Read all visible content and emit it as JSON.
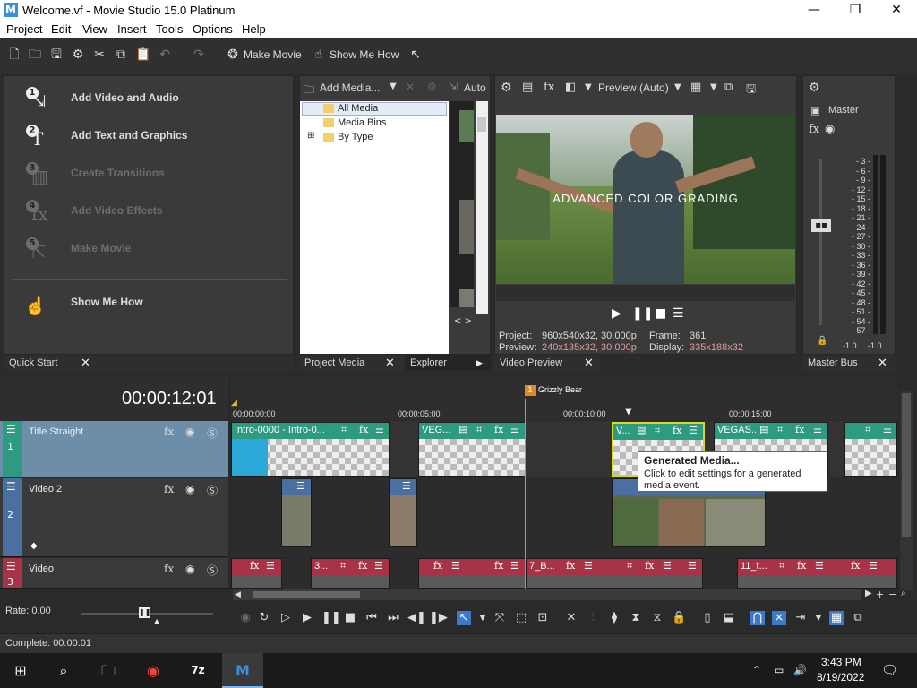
{
  "window": {
    "title": "Welcome.vf - Movie Studio 15.0 Platinum",
    "app_icon": "M",
    "minimize": "—",
    "maximize": "❐",
    "close": "✕"
  },
  "menu": [
    "Project",
    "Edit",
    "View",
    "Insert",
    "Tools",
    "Options",
    "Help"
  ],
  "toolbar": {
    "make_movie": "Make Movie",
    "show_me_how": "Show Me How"
  },
  "quick_start": {
    "items": [
      {
        "n": "1",
        "label": "Add Video and Audio"
      },
      {
        "n": "2",
        "label": "Add Text and Graphics"
      },
      {
        "n": "3",
        "label": "Create Transitions"
      },
      {
        "n": "4",
        "label": "Add Video Effects"
      },
      {
        "n": "5",
        "label": "Make Movie"
      }
    ],
    "show_me_how": "Show Me How",
    "tab": "Quick Start"
  },
  "project_media": {
    "add_media": "Add Media...",
    "auto": "Auto",
    "tree": [
      "All Media",
      "Media Bins",
      "By Type"
    ],
    "tab": "Project Media",
    "tab2": "Explorer"
  },
  "preview": {
    "mode": "Preview (Auto)",
    "overlay_text": "ADVANCED COLOR GRADING",
    "project_label": "Project:",
    "project_value": "960x540x32, 30.000p",
    "frame_label": "Frame:",
    "frame_value": "361",
    "preview_label": "Preview:",
    "preview_value": "240x135x32, 30.000p",
    "display_label": "Display:",
    "display_value": "335x188x32",
    "tab": "Video Preview"
  },
  "master": {
    "label": "Master",
    "scale": [
      "3",
      "6",
      "9",
      "12",
      "15",
      "18",
      "21",
      "24",
      "27",
      "30",
      "33",
      "36",
      "39",
      "42",
      "45",
      "48",
      "51",
      "54",
      "57"
    ],
    "left_val": "-1.0",
    "right_val": "-1.0",
    "tab": "Master Bus"
  },
  "timeline": {
    "timecode": "00:00:12:01",
    "marker": "Grizzly Bear",
    "marker_num": "1",
    "ruler": [
      "00:00:00;00",
      "00:00:05;00",
      "00:00:10;00",
      "00:00:15;00"
    ],
    "tracks": [
      {
        "num": "1",
        "name": "Title Straight"
      },
      {
        "num": "2",
        "name": "Video 2"
      },
      {
        "num": "3",
        "name": "Video"
      }
    ],
    "clips": {
      "c1": "Intro-0000 - Intro-0...",
      "c2": "VEG...",
      "c3": "V...",
      "c4": "VEGAS...",
      "c5": "3...",
      "c6": "7_B...",
      "c7": "11_t..."
    },
    "rate": "Rate: 0.00"
  },
  "tooltip": {
    "title": "Generated Media...",
    "body": "Click to edit settings for a generated media event."
  },
  "status": "Complete: 00:00:01",
  "taskbar": {
    "time": "3:43 PM",
    "date": "8/19/2022",
    "sevenzip": "7z",
    "app": "M"
  }
}
